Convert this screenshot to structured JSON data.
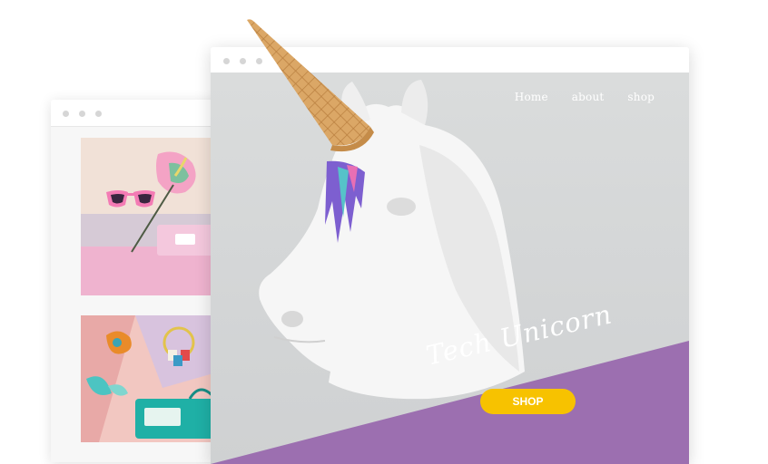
{
  "back_window": {
    "tiles": [
      {
        "name": "fashion-flatlay-sunglasses"
      },
      {
        "name": "fashion-flatlay-jewelry"
      }
    ]
  },
  "front_window": {
    "nav": [
      {
        "label": "Home"
      },
      {
        "label": "about"
      },
      {
        "label": "shop"
      }
    ],
    "hero": {
      "brand": "Tech Unicorn",
      "cta_label": "SHOP"
    }
  },
  "colors": {
    "accent_purple": "#9c6fb0",
    "button_yellow": "#f7c200",
    "hero_grey": "#d5d7d8",
    "cone": "#d9a25e"
  }
}
